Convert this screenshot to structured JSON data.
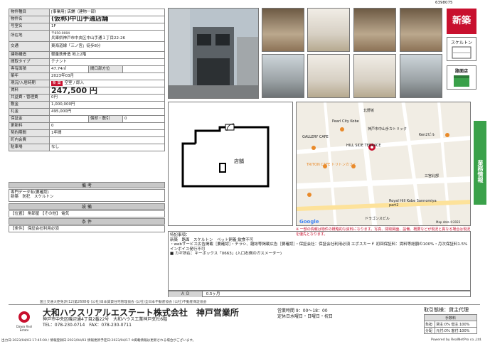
{
  "ref_number": "6398075",
  "table": [
    {
      "label": "物件種目",
      "value": "[事業用] 店舗（建物一部）"
    },
    {
      "label": "物件名",
      "value": "(仮称)中山手通店舗"
    },
    {
      "label": "号室名",
      "value": "1F"
    },
    {
      "label": "所在地",
      "zip": "〒650-0004",
      "value": "兵庫県神戸市中央区中山手通１丁目22-26"
    },
    {
      "label": "交通",
      "value": "東海道線「三ノ宮」徒歩8分"
    },
    {
      "label": "建物構造",
      "value": "軽量鉄骨造 地上2階"
    },
    {
      "label": "間取タイプ",
      "value": "テナント"
    },
    {
      "label": "専有面積",
      "value": "47.74㎡",
      "sub_label": "間口部方位",
      "sub_value": ""
    },
    {
      "label": "築年",
      "value": "2023年03月"
    },
    {
      "label": "現況/入居時期",
      "tag": "新 築",
      "value": "空室 / 即入"
    },
    {
      "label": "賃料",
      "value": "247,500 円"
    },
    {
      "label": "共益費・管理費",
      "value": "0円"
    },
    {
      "label": "敷金",
      "value": "1,000,000円"
    },
    {
      "label": "礼金",
      "value": "495,000円"
    },
    {
      "label": "保証金",
      "value": "",
      "sub_label": "償却・敷引",
      "sub_value": "0"
    },
    {
      "label": "更新料",
      "value": "0"
    },
    {
      "label": "契約期間",
      "value": "1年間"
    },
    {
      "label": "町内会費",
      "value": ""
    },
    {
      "label": "駐車場",
      "value": "なし"
    }
  ],
  "sections": {
    "remarks_title": "備 考",
    "remarks_text": "専門データ有(要確認)\n新築　防犯　スケルトン",
    "equipment_title": "設 備",
    "equipment_text": "【位置】 角部屋 【その他】 電気",
    "conditions_title": "条 件",
    "conditions_text": "【条件】 保証会社利用必須"
  },
  "badges": {
    "new": "新築",
    "skeleton": "スケルトン",
    "roadside": "路面店"
  },
  "green_tab": "業務情報",
  "floor_plan_label": "店舗",
  "map": {
    "labels": [
      "Pearl City Kobe",
      "GALLERY CAFE",
      "HILL SIDE TERRACE",
      "TRITON CAFE トリトンカフェ",
      "Royal Hill Kobe Sannomiya part2",
      "ドラゴンスビル",
      "神戸市中山手カトリック",
      "北野坂",
      "Ken2ビル",
      "三宮北部",
      "Google",
      "Map data ©2023"
    ],
    "note": "※ 一部の情報は物件の概略的な資料になります。写真、間取図面、設備、概要などが現況と異なる場合は現況を優先となります。"
  },
  "remarks_box": "特記事項：\n新築　路面　スケルトン　ペット飼養 飲食不可\n・webサービス広告掲載［要確認］・チラシ、雑誌等掲載広告［要確認］・保証会社：保証会社利用必須 エポスカード 初回保証料：賃料等総額の100%・月次保証料1.5%\nインボイス発行不可\n■ カギ所在：キーボックス「0663」(入口右側のガスメーター)",
  "ad": {
    "label": "Ａ Ｄ",
    "value": "0.5ヶ月"
  },
  "license": "国土交通大臣免許(12)第2608号 (公社)日本賃貸住宅管理協会 (公社)全日本不動産協会 (公社)不動産保証協会",
  "company": {
    "name": "大和ハウスリアルエステート株式会社　神戸営業所",
    "address": "神戸市中央区磯辺通4丁目2番22号　大和ハウス工業神戸支社6階",
    "phone": "TEL：078-230-0714　FAX：078-230-0711",
    "hours_label": "営業時間 9：00～18：00",
    "holidays": "定休日水曜日・日曜日・祝日",
    "logo_text": "Daiwa Real Estate"
  },
  "terms": {
    "title": "取引態様：貸主代理",
    "fee_title": "手数料",
    "rows": [
      {
        "label": "負担",
        "value": "貸主:0% 借主:100%"
      },
      {
        "label": "分配",
        "value": "元付:0% 客付:100%"
      }
    ]
  },
  "bottom": {
    "left": "出力日:2023/04/03 17:45:00 / 情報登録日:2023/04/03 情報更新予定日:2023/04/17 ※掲載情報は更新される場合がございます。",
    "right": "Powered by RealNetPro co.,Ltd."
  }
}
